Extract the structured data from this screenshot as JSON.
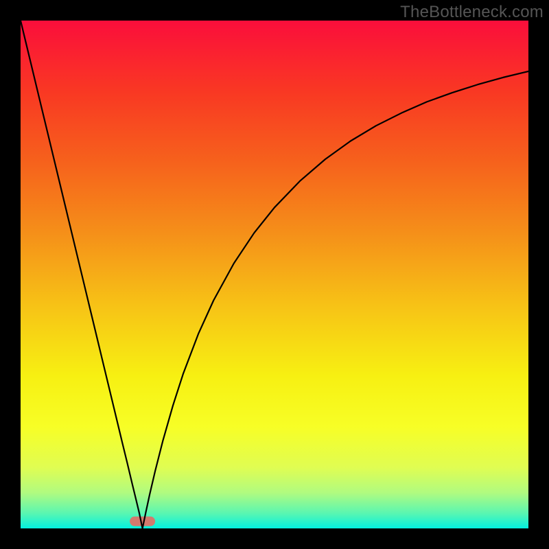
{
  "watermark": "TheBottleneck.com",
  "chart_data": {
    "type": "line",
    "title": "",
    "xlabel": "",
    "ylabel": "",
    "xlim": [
      0,
      100
    ],
    "ylim": [
      0,
      100
    ],
    "grid": false,
    "legend": false,
    "annotations": [],
    "background_gradient_stops": [
      {
        "offset": 0.0,
        "color": "#fb0e3b"
      },
      {
        "offset": 0.14,
        "color": "#f93823"
      },
      {
        "offset": 0.28,
        "color": "#f6621c"
      },
      {
        "offset": 0.42,
        "color": "#f59019"
      },
      {
        "offset": 0.56,
        "color": "#f7c216"
      },
      {
        "offset": 0.7,
        "color": "#f7f012"
      },
      {
        "offset": 0.8,
        "color": "#f7fe26"
      },
      {
        "offset": 0.88,
        "color": "#e0fd52"
      },
      {
        "offset": 0.93,
        "color": "#b0fb80"
      },
      {
        "offset": 0.97,
        "color": "#5af6b1"
      },
      {
        "offset": 1.0,
        "color": "#03f1e0"
      }
    ],
    "marker_band": {
      "x_center": 24,
      "x_halfwidth": 2.5,
      "y": 1.4,
      "color": "#d37a6e"
    },
    "series": [
      {
        "name": "curve",
        "color": "#000000",
        "x": [
          0,
          2,
          4,
          6,
          8,
          10,
          12,
          14,
          16,
          18,
          20,
          21,
          22,
          22.8,
          23.4,
          24,
          24.6,
          25.4,
          26.5,
          28,
          30,
          32,
          35,
          38,
          42,
          46,
          50,
          55,
          60,
          65,
          70,
          75,
          80,
          85,
          90,
          95,
          100
        ],
        "y": [
          100,
          91.7,
          83.4,
          75.1,
          66.8,
          58.5,
          50.2,
          41.9,
          33.6,
          25.3,
          17.0,
          12.9,
          8.7,
          5.4,
          2.9,
          0.0,
          2.9,
          6.6,
          11.3,
          17.2,
          24.2,
          30.4,
          38.3,
          44.9,
          52.2,
          58.2,
          63.2,
          68.4,
          72.7,
          76.3,
          79.3,
          81.8,
          84.0,
          85.8,
          87.4,
          88.8,
          90.0
        ]
      }
    ]
  }
}
